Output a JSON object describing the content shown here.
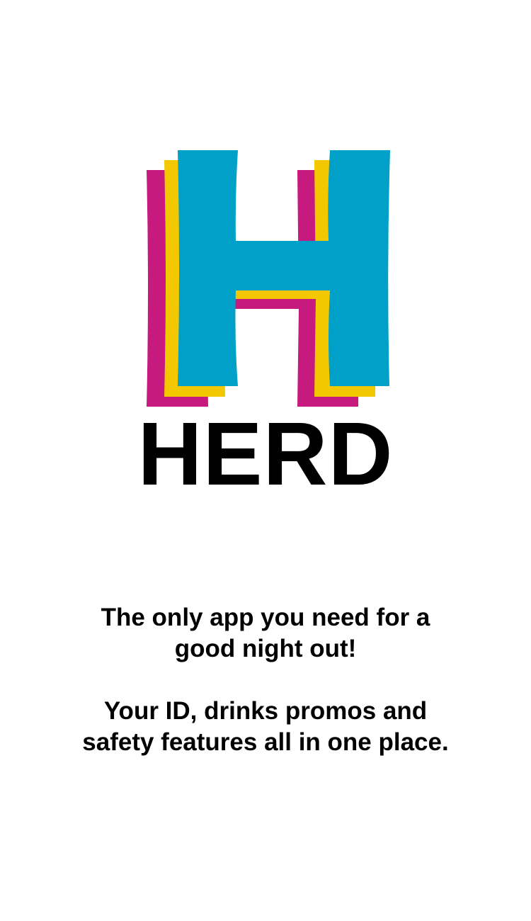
{
  "brand": {
    "name": "HERD",
    "logo_icon": "stacked-h-logo",
    "colors": {
      "magenta": "#c71a7f",
      "yellow": "#f4c800",
      "cyan": "#00a0c8",
      "text": "#000000",
      "background": "#ffffff"
    }
  },
  "tagline": {
    "line1": "The only app you need for a good night out!",
    "line2": "Your ID, drinks promos and safety features all in one place."
  }
}
